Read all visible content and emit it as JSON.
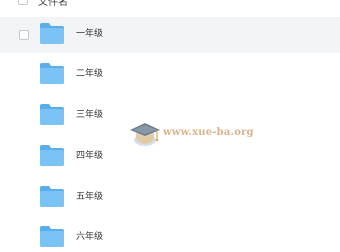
{
  "header": {
    "label": "文件名",
    "sort_icon": "sort-arrow-icon"
  },
  "folders": [
    {
      "name": "一年级",
      "selected": true,
      "icon": "folder-icon"
    },
    {
      "name": "二年级",
      "selected": false,
      "icon": "folder-icon"
    },
    {
      "name": "三年级",
      "selected": false,
      "icon": "folder-icon"
    },
    {
      "name": "四年级",
      "selected": false,
      "icon": "folder-icon"
    },
    {
      "name": "五年级",
      "selected": false,
      "icon": "folder-icon"
    },
    {
      "name": "六年级",
      "selected": false,
      "icon": "folder-icon"
    }
  ],
  "watermark": {
    "text": "www.xue-ba.org",
    "icon": "graduation-cap-icon"
  },
  "colors": {
    "folder_body": "#7cc3f5",
    "folder_tab": "#5aaeea",
    "selected_row": "#f3f4f6",
    "watermark_text": "#d9b48a"
  }
}
